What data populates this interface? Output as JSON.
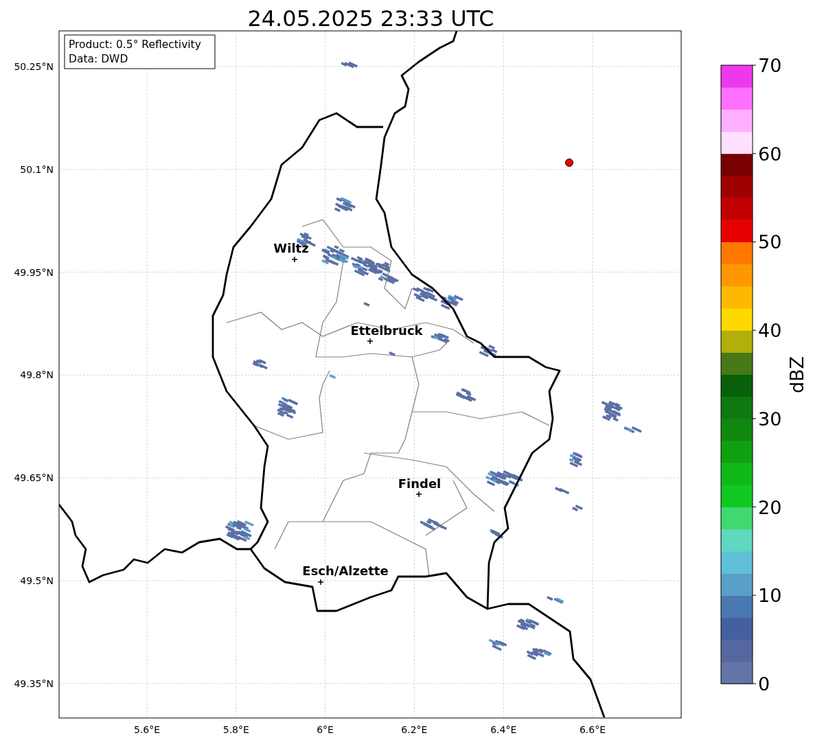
{
  "title": "24.05.2025 23:33 UTC",
  "info_box": [
    "Product: 0.5° Reflectivity",
    "Data: DWD"
  ],
  "map": {
    "lat_ticks": [
      "50.25°N",
      "50.1°N",
      "49.95°N",
      "49.8°N",
      "49.65°N",
      "49.5°N",
      "49.35°N"
    ],
    "lon_ticks": [
      "5.6°E",
      "5.8°E",
      "6°E",
      "6.2°E",
      "6.4°E",
      "6.6°E"
    ],
    "places": [
      {
        "name": "Wiltz"
      },
      {
        "name": "Ettelbruck"
      },
      {
        "name": "Findel"
      },
      {
        "name": "Esch/Alzette"
      }
    ]
  },
  "colorbar": {
    "label": "dBZ",
    "ticks": [
      "70",
      "60",
      "50",
      "40",
      "30",
      "20",
      "10",
      "0"
    ],
    "segments": [
      {
        "color": "#6474a8"
      },
      {
        "color": "#54689f"
      },
      {
        "color": "#4460a0"
      },
      {
        "color": "#4a78b0"
      },
      {
        "color": "#58a0c8"
      },
      {
        "color": "#60c0d8"
      },
      {
        "color": "#60d8c0"
      },
      {
        "color": "#40d870"
      },
      {
        "color": "#10c820"
      },
      {
        "color": "#10b818"
      },
      {
        "color": "#10a010"
      },
      {
        "color": "#108810"
      },
      {
        "color": "#107810"
      },
      {
        "color": "#086008"
      },
      {
        "color": "#487818"
      },
      {
        "color": "#b0b008"
      },
      {
        "color": "#ffd800"
      },
      {
        "color": "#ffb800"
      },
      {
        "color": "#ff9800"
      },
      {
        "color": "#ff7800"
      },
      {
        "color": "#e80000"
      },
      {
        "color": "#c00000"
      },
      {
        "color": "#a00000"
      },
      {
        "color": "#780000"
      },
      {
        "color": "#ffe0ff"
      },
      {
        "color": "#ffb0ff"
      },
      {
        "color": "#ff70ff"
      },
      {
        "color": "#ee38ee"
      }
    ]
  }
}
